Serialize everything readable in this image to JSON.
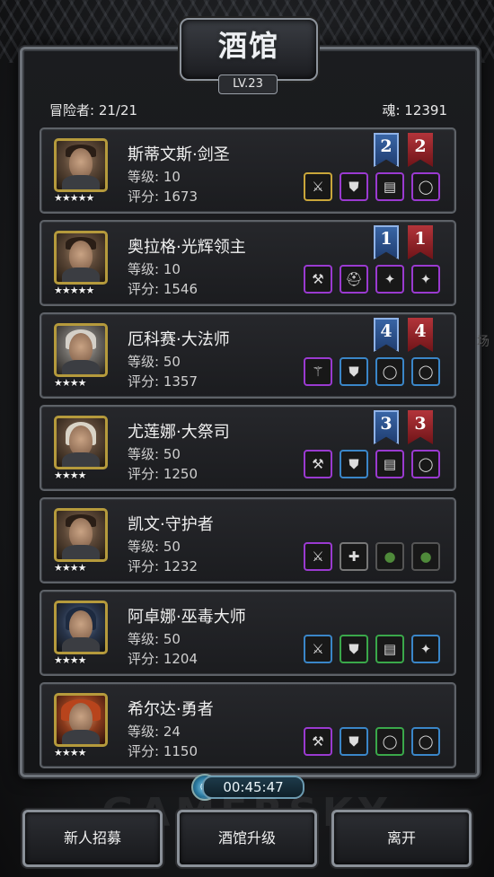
{
  "header": {
    "title": "酒馆",
    "level": "LV.23",
    "adventurers": "冒险者: 21/21",
    "souls": "魂: 12391"
  },
  "heroes": [
    {
      "name": "斯蒂文斯·剑圣",
      "level": "等级: 10",
      "score": "评分: 1673",
      "stars": "★★★★★",
      "rank_blue": "2",
      "rank_red": "2",
      "equipment": [
        {
          "icon": "sword-icon",
          "glyph": "⚔",
          "color": "gold"
        },
        {
          "icon": "armor-icon",
          "glyph": "⛊",
          "color": "purple"
        },
        {
          "icon": "scroll-icon",
          "glyph": "▤",
          "color": "purple"
        },
        {
          "icon": "ring-icon",
          "glyph": "◯",
          "color": "purple"
        }
      ]
    },
    {
      "name": "奥拉格·光辉领主",
      "level": "等级: 10",
      "score": "评分: 1546",
      "stars": "★★★★★",
      "rank_blue": "1",
      "rank_red": "1",
      "equipment": [
        {
          "icon": "hammer-icon",
          "glyph": "⚒",
          "color": "purple"
        },
        {
          "icon": "helmet-icon",
          "glyph": "⛑",
          "color": "purple"
        },
        {
          "icon": "amulet-icon",
          "glyph": "✦",
          "color": "purple"
        },
        {
          "icon": "amulet-icon",
          "glyph": "✦",
          "color": "purple"
        }
      ]
    },
    {
      "name": "厄科赛·大法师",
      "level": "等级: 50",
      "score": "评分: 1357",
      "stars": "★★★★",
      "rank_blue": "4",
      "rank_red": "4",
      "equipment": [
        {
          "icon": "staff-icon",
          "glyph": "⚚",
          "color": "purple"
        },
        {
          "icon": "armor-icon",
          "glyph": "⛊",
          "color": "blue"
        },
        {
          "icon": "ring-icon",
          "glyph": "◯",
          "color": "blue"
        },
        {
          "icon": "ring-icon",
          "glyph": "◯",
          "color": "blue"
        }
      ]
    },
    {
      "name": "尤莲娜·大祭司",
      "level": "等级: 50",
      "score": "评分: 1250",
      "stars": "★★★★",
      "rank_blue": "3",
      "rank_red": "3",
      "equipment": [
        {
          "icon": "hammer-icon",
          "glyph": "⚒",
          "color": "purple"
        },
        {
          "icon": "armor-icon",
          "glyph": "⛊",
          "color": "blue"
        },
        {
          "icon": "scroll-icon",
          "glyph": "▤",
          "color": "purple"
        },
        {
          "icon": "ring-icon",
          "glyph": "◯",
          "color": "purple"
        }
      ]
    },
    {
      "name": "凯文·守护者",
      "level": "等级: 50",
      "score": "评分: 1232",
      "stars": "★★★★",
      "rank_blue": "",
      "rank_red": "",
      "equipment": [
        {
          "icon": "sword-icon",
          "glyph": "⚔",
          "color": "purple"
        },
        {
          "icon": "empty-armor-slot-icon",
          "glyph": "✚",
          "color": "gray"
        },
        {
          "icon": "empty-slot-icon",
          "glyph": "●",
          "color": "empty"
        },
        {
          "icon": "empty-slot-icon",
          "glyph": "●",
          "color": "empty"
        }
      ]
    },
    {
      "name": "阿卓娜·巫毒大师",
      "level": "等级: 50",
      "score": "评分: 1204",
      "stars": "★★★★",
      "rank_blue": "",
      "rank_red": "",
      "equipment": [
        {
          "icon": "dagger-icon",
          "glyph": "⚔",
          "color": "blue"
        },
        {
          "icon": "armor-icon",
          "glyph": "⛊",
          "color": "green"
        },
        {
          "icon": "scroll-icon",
          "glyph": "▤",
          "color": "green"
        },
        {
          "icon": "amulet-icon",
          "glyph": "✦",
          "color": "blue"
        }
      ]
    },
    {
      "name": "希尔达·勇者",
      "level": "等级: 24",
      "score": "评分: 1150",
      "stars": "★★★★",
      "rank_blue": "",
      "rank_red": "",
      "equipment": [
        {
          "icon": "axe-icon",
          "glyph": "⚒",
          "color": "purple"
        },
        {
          "icon": "armor-icon",
          "glyph": "⛊",
          "color": "blue"
        },
        {
          "icon": "ring-icon",
          "glyph": "◯",
          "color": "green"
        },
        {
          "icon": "ring-icon",
          "glyph": "◯",
          "color": "blue"
        }
      ]
    }
  ],
  "timer": "00:45:47",
  "buttons": {
    "recruit": "新人招募",
    "upgrade": "酒馆升级",
    "leave": "离开"
  },
  "watermark": "GAMERSKY",
  "side_text": "场"
}
